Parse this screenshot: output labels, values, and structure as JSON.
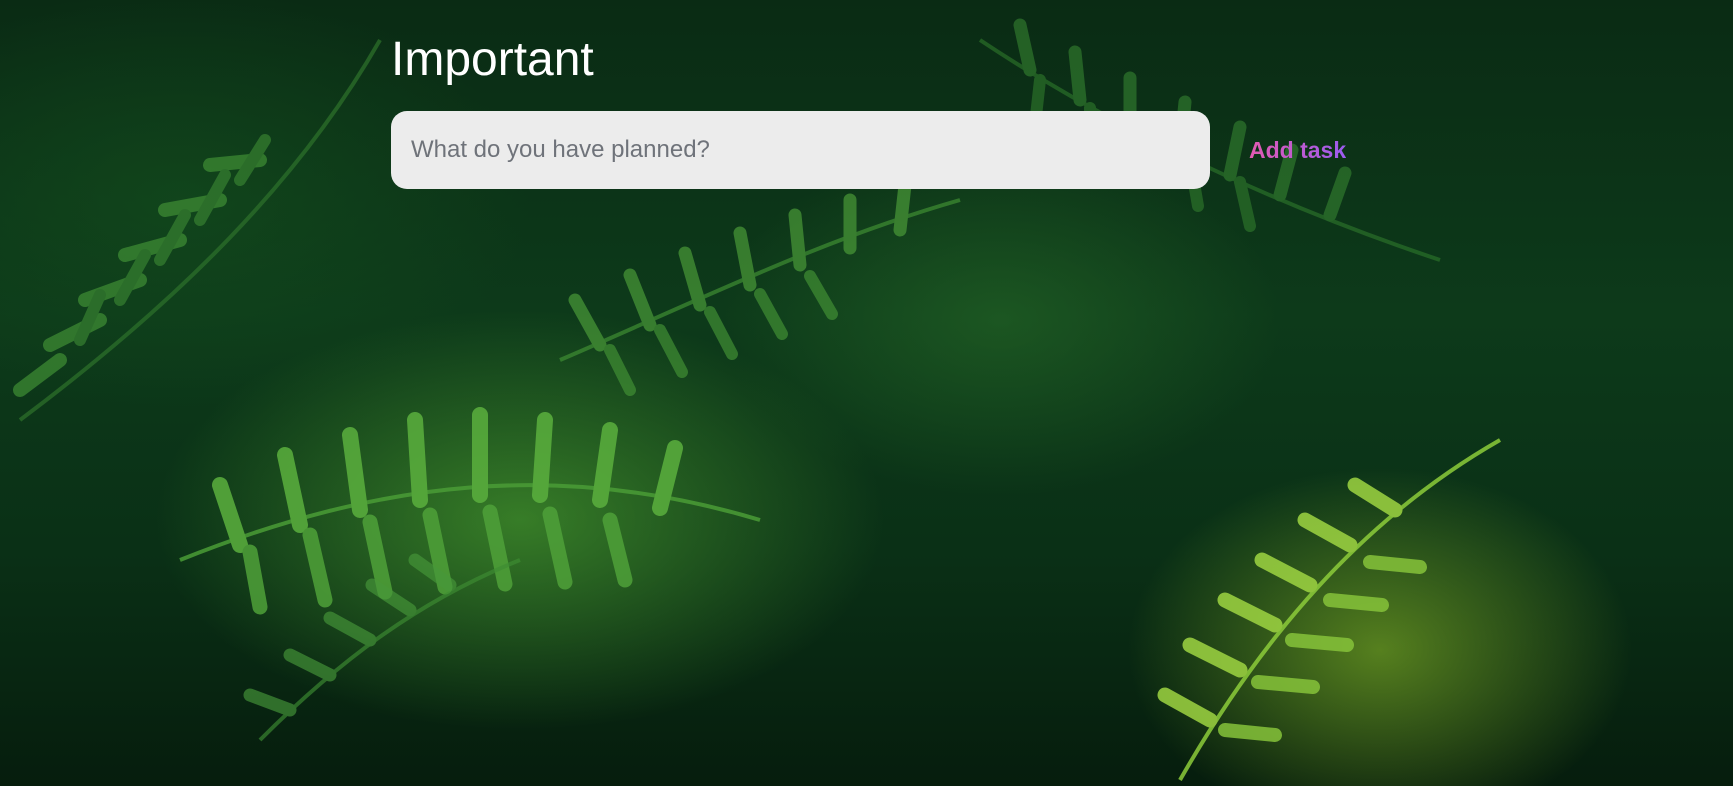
{
  "page": {
    "title": "Important"
  },
  "task_form": {
    "input_value": "",
    "input_placeholder": "What do you have planned?",
    "add_button_label": "Add task"
  },
  "background": {
    "image": "fern-leaves-photo",
    "colors": [
      "#0a2b14",
      "#2f7d2a",
      "#8fd03a"
    ]
  },
  "colors": {
    "title_text": "#ffffff",
    "input_background": "#ececec",
    "button_gradient_start": "#e25ab0",
    "button_gradient_end": "#9b5cf0"
  }
}
